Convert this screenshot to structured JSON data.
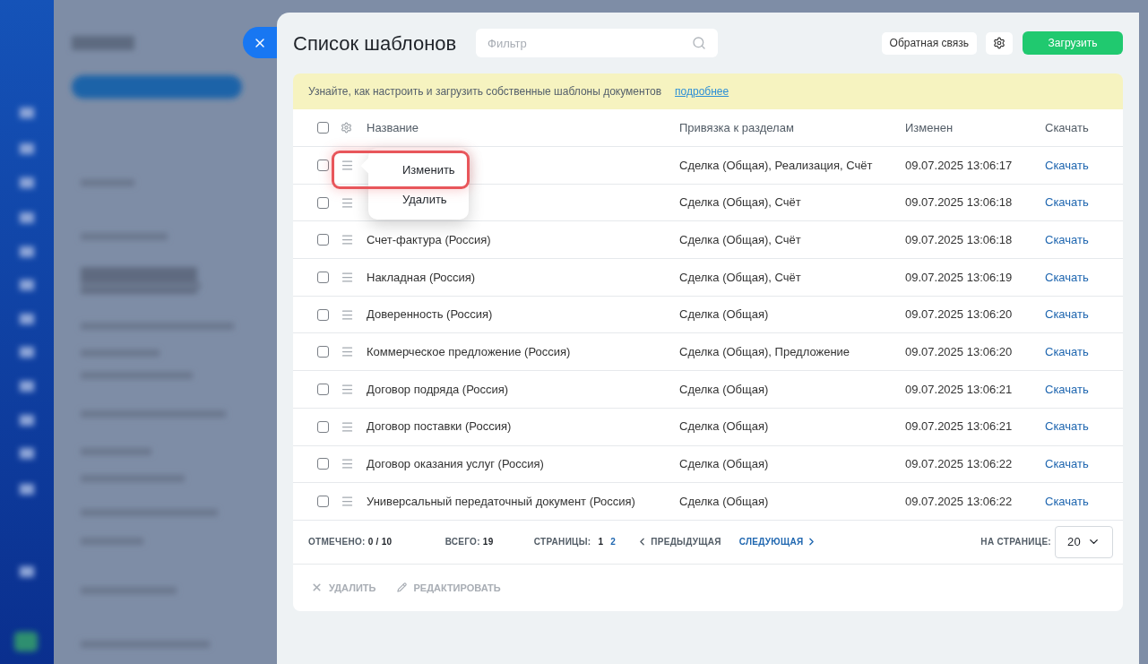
{
  "title": "Список шаблонов",
  "filter": {
    "placeholder": "Фильтр"
  },
  "header_buttons": {
    "feedback": "Обратная связь",
    "upload": "Загрузить"
  },
  "banner": {
    "text": "Узнайте, как настроить и загрузить собственные шаблоны документов",
    "link": "подробнее"
  },
  "table": {
    "select_all_checked": false,
    "columns": [
      "Название",
      "Привязка к разделам",
      "Изменен",
      "Скачать"
    ],
    "rows": [
      {
        "checked": false,
        "binding": "Сделка (Общая), Реализация, Счёт",
        "modified": "09.07.2025 13:06:17",
        "download": "Скачать"
      },
      {
        "checked": false,
        "binding": "Сделка (Общая), Счёт",
        "modified": "09.07.2025 13:06:18",
        "download": "Скачать"
      },
      {
        "checked": false,
        "name": "Счет-фактура (Россия)",
        "binding": "Сделка (Общая), Счёт",
        "modified": "09.07.2025 13:06:18",
        "download": "Скачать"
      },
      {
        "checked": false,
        "name": "Накладная (Россия)",
        "binding": "Сделка (Общая), Счёт",
        "modified": "09.07.2025 13:06:19",
        "download": "Скачать"
      },
      {
        "checked": false,
        "name": "Доверенность (Россия)",
        "binding": "Сделка (Общая)",
        "modified": "09.07.2025 13:06:20",
        "download": "Скачать"
      },
      {
        "checked": false,
        "name": "Коммерческое предложение (Россия)",
        "binding": "Сделка (Общая), Предложение",
        "modified": "09.07.2025 13:06:20",
        "download": "Скачать"
      },
      {
        "checked": false,
        "name": "Договор подряда (Россия)",
        "binding": "Сделка (Общая)",
        "modified": "09.07.2025 13:06:21",
        "download": "Скачать"
      },
      {
        "checked": false,
        "name": "Договор поставки (Россия)",
        "binding": "Сделка (Общая)",
        "modified": "09.07.2025 13:06:21",
        "download": "Скачать"
      },
      {
        "checked": false,
        "name": "Договор оказания услуг (Россия)",
        "binding": "Сделка (Общая)",
        "modified": "09.07.2025 13:06:22",
        "download": "Скачать"
      },
      {
        "checked": false,
        "name": "Универсальный передаточный документ (Россия)",
        "binding": "Сделка (Общая)",
        "modified": "09.07.2025 13:06:22",
        "download": "Скачать"
      }
    ]
  },
  "menu": {
    "items": [
      {
        "label": "Изменить",
        "highlighted": true
      },
      {
        "label": "Удалить",
        "highlighted": false
      }
    ]
  },
  "footer": {
    "checked_label": "ОТМЕЧЕНО:",
    "checked_value": "0 / 10",
    "total_label": "ВСЕГО:",
    "total_value": "19",
    "pages_label": "СТРАНИЦЫ:",
    "pages": [
      {
        "label": "1",
        "selected": true
      },
      {
        "label": "2",
        "selected": false
      }
    ],
    "prev": "ПРЕДЫДУЩАЯ",
    "next": "СЛЕДУЮЩАЯ",
    "per_page_label": "НА СТРАНИЦЕ:",
    "per_page": "20"
  },
  "actions": [
    {
      "kind": "delete",
      "label": "УДАЛИТЬ",
      "disabled": true
    },
    {
      "kind": "edit",
      "label": "РЕДАКТИРОВАТЬ",
      "disabled": true
    }
  ]
}
